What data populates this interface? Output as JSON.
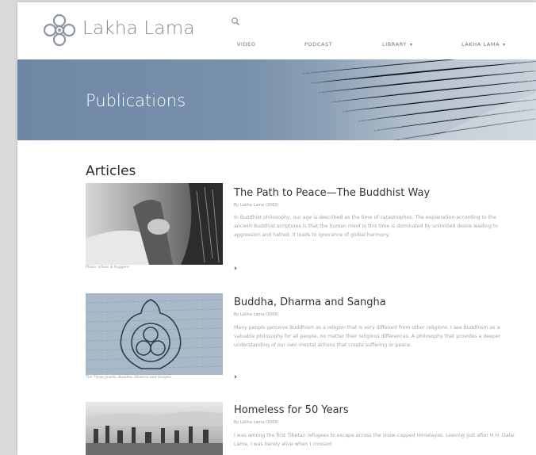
{
  "site": {
    "brand": "Lakha Lama"
  },
  "nav": {
    "items": [
      {
        "label": "VIDEO",
        "has_dropdown": false
      },
      {
        "label": "PODCAST",
        "has_dropdown": false
      },
      {
        "label": "LIBRARY",
        "has_dropdown": true
      },
      {
        "label": "LAKHA LAMA",
        "has_dropdown": true
      }
    ],
    "caret": "▾",
    "search_icon": "search-icon"
  },
  "hero": {
    "title": "Publications"
  },
  "section": {
    "title": "Articles"
  },
  "articles": [
    {
      "title": "The Path to Peace—The Buddhist Way",
      "byline": "By Lakha Lama (2002)",
      "body": "In Buddhist philosophy, our age is described as the time of catastrophes. The explanation according to the ancient Buddhist scriptures is that the human mind in this time is dominated by unlimited desire leading to aggression and hatred. It leads to ignorance of global harmony.",
      "caption": "Photo: Istvan & Ruggero",
      "more": "›"
    },
    {
      "title": "Buddha, Dharma and Sangha",
      "byline": "By Lakha Lama (2006)",
      "body": "Many people perceive Buddhism as a religion that is very different from other religions. I see Buddhism as a valuable philosophy for all people, no matter their religious differences. A philosophy that provides a deeper understanding of our own mental actions that create suffering or peace.",
      "caption": "The Three Jewels: Buddha, Dharma and Sangha",
      "more": "›"
    },
    {
      "title": "Homeless for 50 Years",
      "byline": "By Lakha Lama (2009)",
      "body": "I was among the first Tibetan refugees to escape across the snow-capped Himalayas. Leaving just after H.H. Dalai Lama, I was barely alive when I crossed",
      "caption": "",
      "more": ""
    }
  ],
  "colors": {
    "hero": "#7991ab",
    "brand_text": "#7d8a96",
    "body_text": "#a0a4a8",
    "title_text": "#333333"
  }
}
